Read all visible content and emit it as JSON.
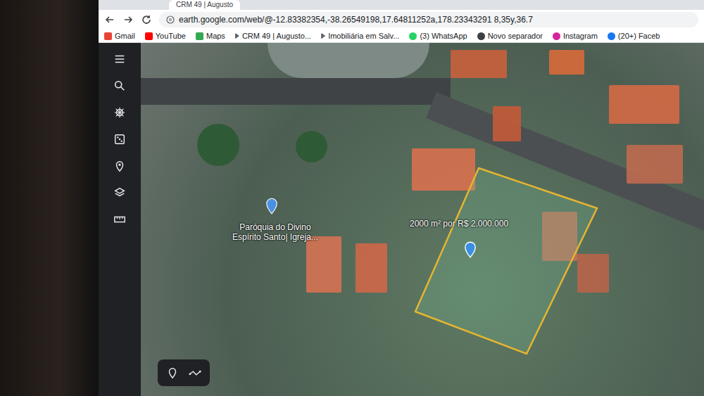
{
  "browser": {
    "tab": {
      "title": "CRM 49 | Augusto",
      "selected": true
    },
    "address": {
      "url": "earth.google.com/web/@-12.83382354,-38.26549198,17.64811252a,178.23343291 8,35y,36.7"
    },
    "bookmarks": [
      {
        "label": "Gmail",
        "kind": "gmail"
      },
      {
        "label": "YouTube",
        "kind": "youtube"
      },
      {
        "label": "Maps",
        "kind": "maps"
      },
      {
        "label": "CRM 49 | Augusto...",
        "kind": "arrow"
      },
      {
        "label": "Imobiliária em Salv...",
        "kind": "arrow"
      },
      {
        "label": "(3) WhatsApp",
        "kind": "whatsapp"
      },
      {
        "label": "Novo separador",
        "kind": "globe"
      },
      {
        "label": "Instagram",
        "kind": "instagram"
      },
      {
        "label": "(20+) Faceb",
        "kind": "facebook"
      }
    ]
  },
  "map": {
    "place": {
      "lines": [
        "Paróquia do Divino",
        "Espírito Santo| Igreja..."
      ]
    },
    "listing": {
      "label": "2000 m² por R$ 2.000.000"
    }
  }
}
